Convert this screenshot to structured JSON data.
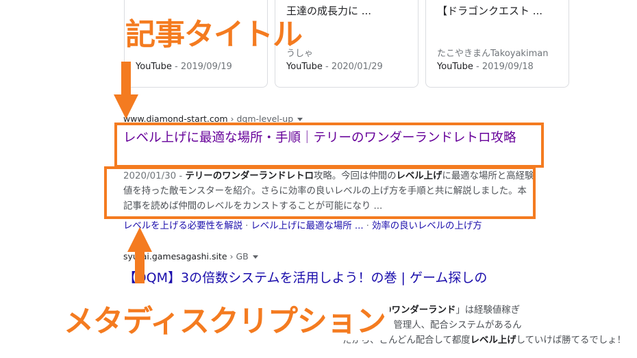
{
  "video_cards": [
    {
      "title": "",
      "author": "",
      "source": "YouTube",
      "date": "2019/09/19"
    },
    {
      "title": "王達の成長力に ...",
      "author": "うしゃ",
      "source": "YouTube",
      "date": "2020/01/29"
    },
    {
      "title": "【ドラゴンクエスト ...",
      "author": "たこやきまんTakoyakiman",
      "source": "YouTube",
      "date": "2019/09/18"
    }
  ],
  "meta_separator": " - ",
  "result1": {
    "cite_domain": "www.diamond-start.com",
    "cite_path": " › dqm-level-up",
    "title": "レベル上げに最適な場所・手順｜テリーのワンダーランドレトロ攻略",
    "snippet_date": "2020/01/30 - ",
    "snippet_parts": [
      {
        "t": "テリーのワンダーランドレトロ",
        "b": true
      },
      {
        "t": "攻略。今回は仲間の",
        "b": false
      },
      {
        "t": "レベル上げ",
        "b": true
      },
      {
        "t": "に最適な場所と高経験値を持った敵モンスターを紹介。さらに効率の良いレベルの上げ方を手順と共に解説しました。本記事を読めば仲間のレベルをカンストすることが可能になり ...",
        "b": false
      }
    ],
    "sitelinks": [
      "レベルを上げる必要性を解説",
      "レベル上げに最適な場所 ...",
      "効率の良いレベルの上げ方"
    ]
  },
  "result2": {
    "cite_domain": "syutai.gamesagashi.site",
    "cite_path": " › GB",
    "title": "【DQM】3の倍数システムを活用しよう！の巻 | ゲーム探しの",
    "snippet_lines": [
      {
        "parts": [
          {
            "t": "ズ テリーのワンダーランド",
            "b": true
          },
          {
            "t": "」は経験値稼ぎ",
            "b": false
          }
        ]
      },
      {
        "parts": [
          {
            "t": "実してい ... 管理人、配合システムがあるん",
            "b": false
          }
        ]
      },
      {
        "parts": [
          {
            "t": "たから、どんどん配合して都度",
            "b": false
          },
          {
            "t": "レベル上げ",
            "b": true
          },
          {
            "t": "していけば勝てるでしょ！",
            "b": false
          }
        ]
      }
    ]
  },
  "annotations": {
    "title_label": "記事タイトル",
    "meta_label": "メタディスクリプション",
    "color": "#f47b20"
  }
}
